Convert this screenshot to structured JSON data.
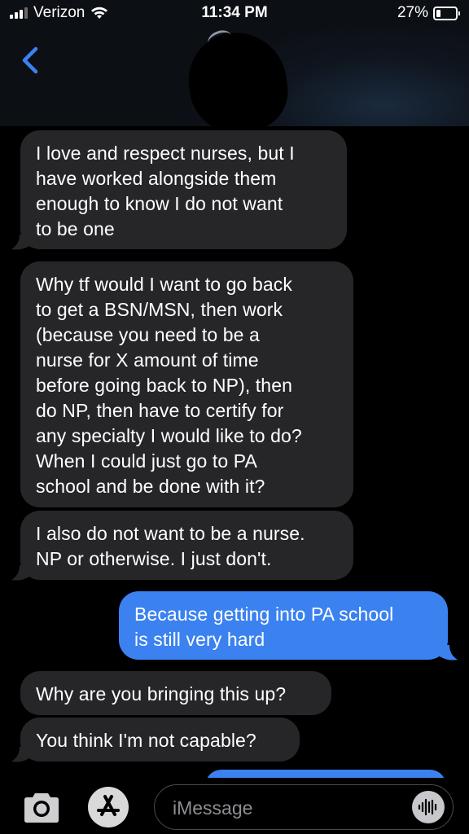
{
  "status_bar": {
    "carrier": "Verizon",
    "time": "11:34 PM",
    "battery_percent": "27%",
    "battery_level": 0.27,
    "signal_bars": 3
  },
  "header": {
    "back_icon": "chevron-left-icon",
    "accent_color": "#3b82f0"
  },
  "messages": [
    {
      "direction": "in",
      "text": "I love and respect nurses, but I have worked alongside them enough to know I do not want to be one"
    },
    {
      "direction": "in",
      "text": "Why tf would I want to go back to get a BSN/MSN, then work (because you need to be a nurse for X amount of time before going back to NP), then do NP, then have to certify for any specialty I would like to do? When I could just go to PA school and be done with it?"
    },
    {
      "direction": "in",
      "text": "I also do not want to be a nurse. NP or otherwise. I just don't."
    },
    {
      "direction": "out",
      "text": "Because getting into PA school is still very hard"
    },
    {
      "direction": "in",
      "text": "Why are you bringing this up?"
    },
    {
      "direction": "in",
      "text": "You think I'm not capable?"
    }
  ],
  "bubble_lines": [
    [
      "I love and respect nurses, but I",
      "have worked alongside them",
      "enough to know I do not want",
      "to be one"
    ],
    [
      "Why tf would I want to go back",
      "to get a BSN/MSN, then work",
      "(because you need to be a",
      "nurse for X amount of time",
      "before going back to NP), then",
      "do NP, then have to certify for",
      "any specialty I would like to do?",
      "When I could just go to PA",
      "school and be done with it?"
    ],
    [
      "I also do not want to be a nurse.",
      "NP or otherwise. I just don't."
    ],
    [
      "Because getting into PA school",
      "is still very hard"
    ],
    [
      "Why are you bringing this up?"
    ],
    [
      "You think I'm not capable?"
    ]
  ],
  "composer": {
    "placeholder": "iMessage",
    "value": "",
    "camera_icon": "camera-icon",
    "apps_icon": "app-store-icon",
    "audio_icon": "audio-waveform-icon"
  },
  "colors": {
    "incoming_bubble": "#262629",
    "outgoing_bubble": "#3b82f0",
    "background": "#000000"
  }
}
